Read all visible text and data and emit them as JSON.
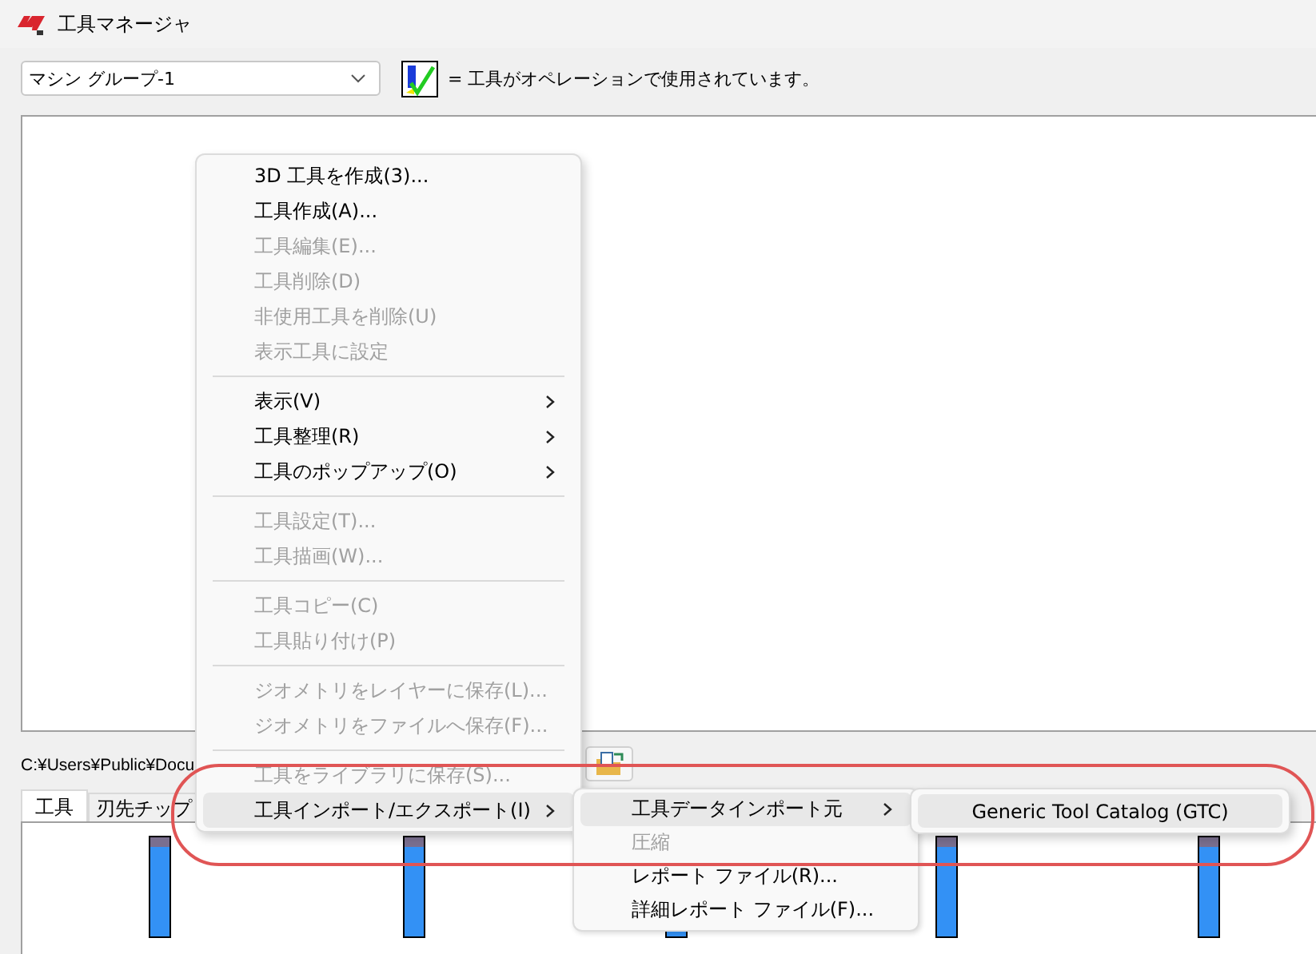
{
  "window": {
    "title": "工具マネージャ"
  },
  "machine_group": {
    "value": "マシン グループ-1"
  },
  "legend": {
    "text": "= 工具がオペレーションで使用されています。"
  },
  "path": {
    "text": "C:¥Users¥Public¥Docu"
  },
  "tabs": [
    {
      "label": "工具",
      "selected": true
    },
    {
      "label": "刃先チップ",
      "selected": false
    }
  ],
  "context_menu": {
    "items": [
      {
        "kind": "item",
        "label": "3D 工具を作成(3)...",
        "disabled": false,
        "submenu": false,
        "selected": false
      },
      {
        "kind": "item",
        "label": "工具作成(A)...",
        "disabled": false,
        "submenu": false,
        "selected": false
      },
      {
        "kind": "item",
        "label": "工具編集(E)...",
        "disabled": true,
        "submenu": false,
        "selected": false
      },
      {
        "kind": "item",
        "label": "工具削除(D)",
        "disabled": true,
        "submenu": false,
        "selected": false
      },
      {
        "kind": "item",
        "label": "非使用工具を削除(U)",
        "disabled": true,
        "submenu": false,
        "selected": false
      },
      {
        "kind": "item",
        "label": "表示工具に設定",
        "disabled": true,
        "submenu": false,
        "selected": false
      },
      {
        "kind": "separator"
      },
      {
        "kind": "item",
        "label": "表示(V)",
        "disabled": false,
        "submenu": true,
        "selected": false
      },
      {
        "kind": "item",
        "label": "工具整理(R)",
        "disabled": false,
        "submenu": true,
        "selected": false
      },
      {
        "kind": "item",
        "label": "工具のポップアップ(O)",
        "disabled": false,
        "submenu": true,
        "selected": false
      },
      {
        "kind": "separator"
      },
      {
        "kind": "item",
        "label": "工具設定(T)...",
        "disabled": true,
        "submenu": false,
        "selected": false
      },
      {
        "kind": "item",
        "label": "工具描画(W)...",
        "disabled": true,
        "submenu": false,
        "selected": false
      },
      {
        "kind": "separator"
      },
      {
        "kind": "item",
        "label": "工具コピー(C)",
        "disabled": true,
        "submenu": false,
        "selected": false
      },
      {
        "kind": "item",
        "label": "工具貼り付け(P)",
        "disabled": true,
        "submenu": false,
        "selected": false
      },
      {
        "kind": "separator"
      },
      {
        "kind": "item",
        "label": "ジオメトリをレイヤーに保存(L)...",
        "disabled": true,
        "submenu": false,
        "selected": false
      },
      {
        "kind": "item",
        "label": "ジオメトリをファイルへ保存(F)...",
        "disabled": true,
        "submenu": false,
        "selected": false
      },
      {
        "kind": "separator"
      },
      {
        "kind": "item",
        "label": "工具をライブラリに保存(S)...",
        "disabled": true,
        "submenu": false,
        "selected": false
      },
      {
        "kind": "item",
        "label": "工具インポート/エクスポート(I)",
        "disabled": false,
        "submenu": true,
        "selected": true
      }
    ]
  },
  "submenu": {
    "items": [
      {
        "kind": "item",
        "label": "工具データインポート元",
        "disabled": false,
        "submenu": true,
        "selected": true
      },
      {
        "kind": "item",
        "label": "圧縮",
        "disabled": true,
        "submenu": false,
        "selected": false
      },
      {
        "kind": "item",
        "label": "レポート ファイル(R)...",
        "disabled": false,
        "submenu": false,
        "selected": false
      },
      {
        "kind": "item",
        "label": "詳細レポート ファイル(F)...",
        "disabled": false,
        "submenu": false,
        "selected": false
      }
    ]
  },
  "sub_submenu": {
    "items": [
      {
        "kind": "item",
        "label": "Generic Tool Catalog (GTC)",
        "disabled": false,
        "submenu": false,
        "selected": true
      }
    ]
  }
}
